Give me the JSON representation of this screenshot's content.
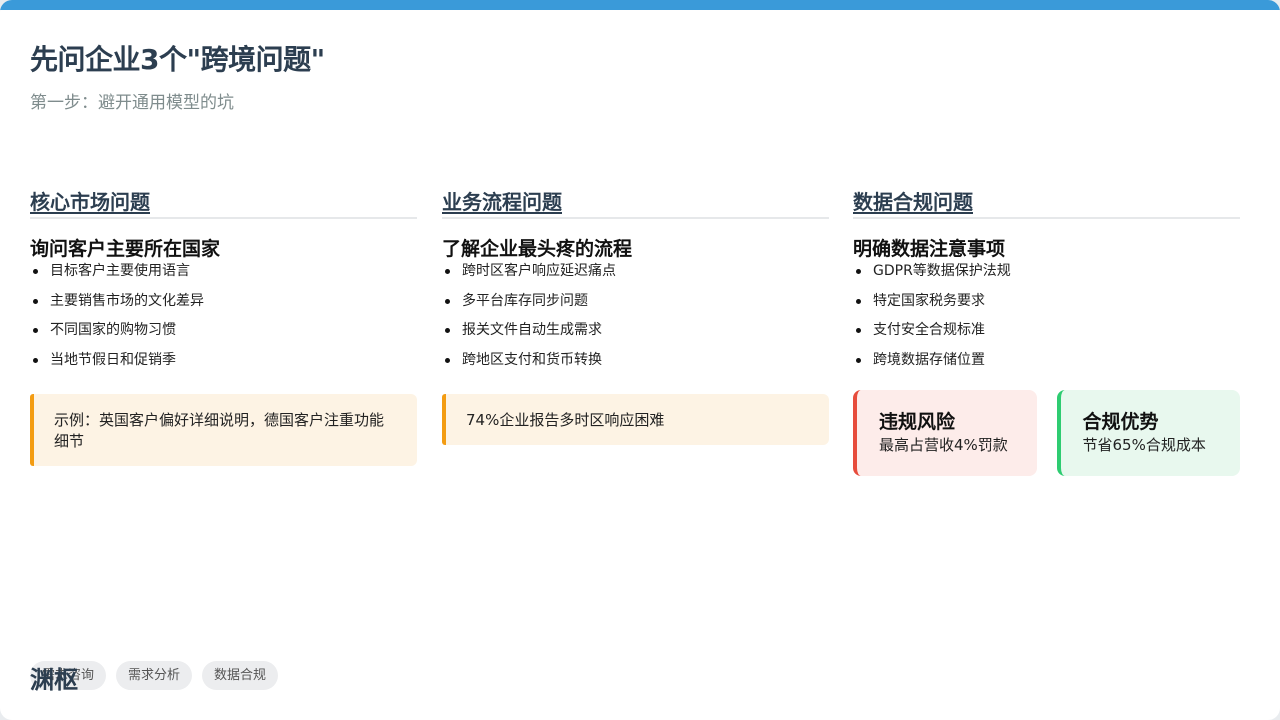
{
  "header": {
    "title": "先问企业3个\"跨境问题\"",
    "subtitle": "第一步：避开通用模型的坑",
    "accent_color": "#3a9ad9"
  },
  "columns": [
    {
      "heading": "核心市场问题",
      "subheading": "询问客户主要所在国家",
      "bullets": [
        "目标客户主要使用语言",
        "主要销售市场的文化差异",
        "不同国家的购物习惯",
        "当地节假日和促销季"
      ],
      "note": "示例：英国客户偏好详细说明，德国客户注重功能细节"
    },
    {
      "heading": "业务流程问题",
      "subheading": "了解企业最头疼的流程",
      "bullets": [
        "跨时区客户响应延迟痛点",
        "多平台库存同步问题",
        "报关文件自动生成需求",
        "跨地区支付和货币转换"
      ],
      "note": "74%企业报告多时区响应困难"
    },
    {
      "heading": "数据合规问题",
      "subheading": "明确数据注意事项",
      "bullets": [
        "GDPR等数据保护法规",
        "特定国家税务要求",
        "支付安全合规标准",
        "跨境数据存储位置"
      ],
      "cards": [
        {
          "title": "违规风险",
          "text": "最高占营收4%罚款",
          "color": "#e74c3c"
        },
        {
          "title": "合规优势",
          "text": "节省65%合规成本",
          "color": "#2ecc71"
        }
      ]
    }
  ],
  "footer": {
    "tags": [
      "需求咨询",
      "需求分析",
      "数据合规"
    ],
    "logo": "渊枢"
  }
}
